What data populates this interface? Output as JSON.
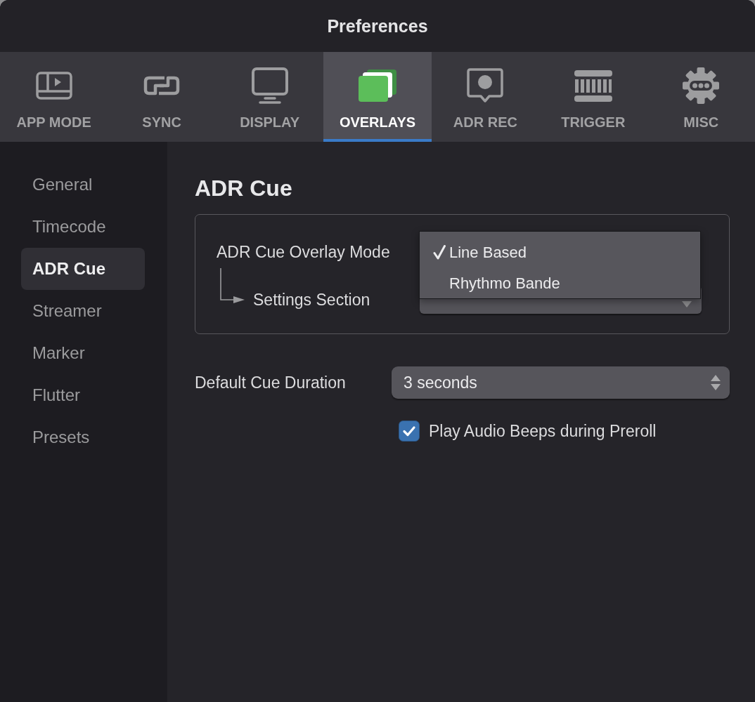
{
  "window": {
    "title": "Preferences"
  },
  "tabs": [
    {
      "label": "APP MODE",
      "selected": false
    },
    {
      "label": "SYNC",
      "selected": false
    },
    {
      "label": "DISPLAY",
      "selected": false
    },
    {
      "label": "OVERLAYS",
      "selected": true
    },
    {
      "label": "ADR REC",
      "selected": false
    },
    {
      "label": "TRIGGER",
      "selected": false
    },
    {
      "label": "MISC",
      "selected": false
    }
  ],
  "sidebar": {
    "items": [
      {
        "label": "General",
        "selected": false
      },
      {
        "label": "Timecode",
        "selected": false
      },
      {
        "label": "ADR Cue",
        "selected": true
      },
      {
        "label": "Streamer",
        "selected": false
      },
      {
        "label": "Marker",
        "selected": false
      },
      {
        "label": "Flutter",
        "selected": false
      },
      {
        "label": "Presets",
        "selected": false
      }
    ]
  },
  "content": {
    "heading": "ADR Cue",
    "overlay_group": {
      "mode_label": "ADR Cue Overlay Mode",
      "mode_menu": {
        "items": [
          {
            "label": "Line Based",
            "selected": true
          },
          {
            "label": "Rhythmo Bande",
            "selected": false
          }
        ]
      },
      "section_label": "Settings Section"
    },
    "duration": {
      "label": "Default Cue Duration",
      "value": "3 seconds"
    },
    "preroll_beeps": {
      "label": "Play Audio Beeps during Preroll",
      "checked": true
    }
  }
}
